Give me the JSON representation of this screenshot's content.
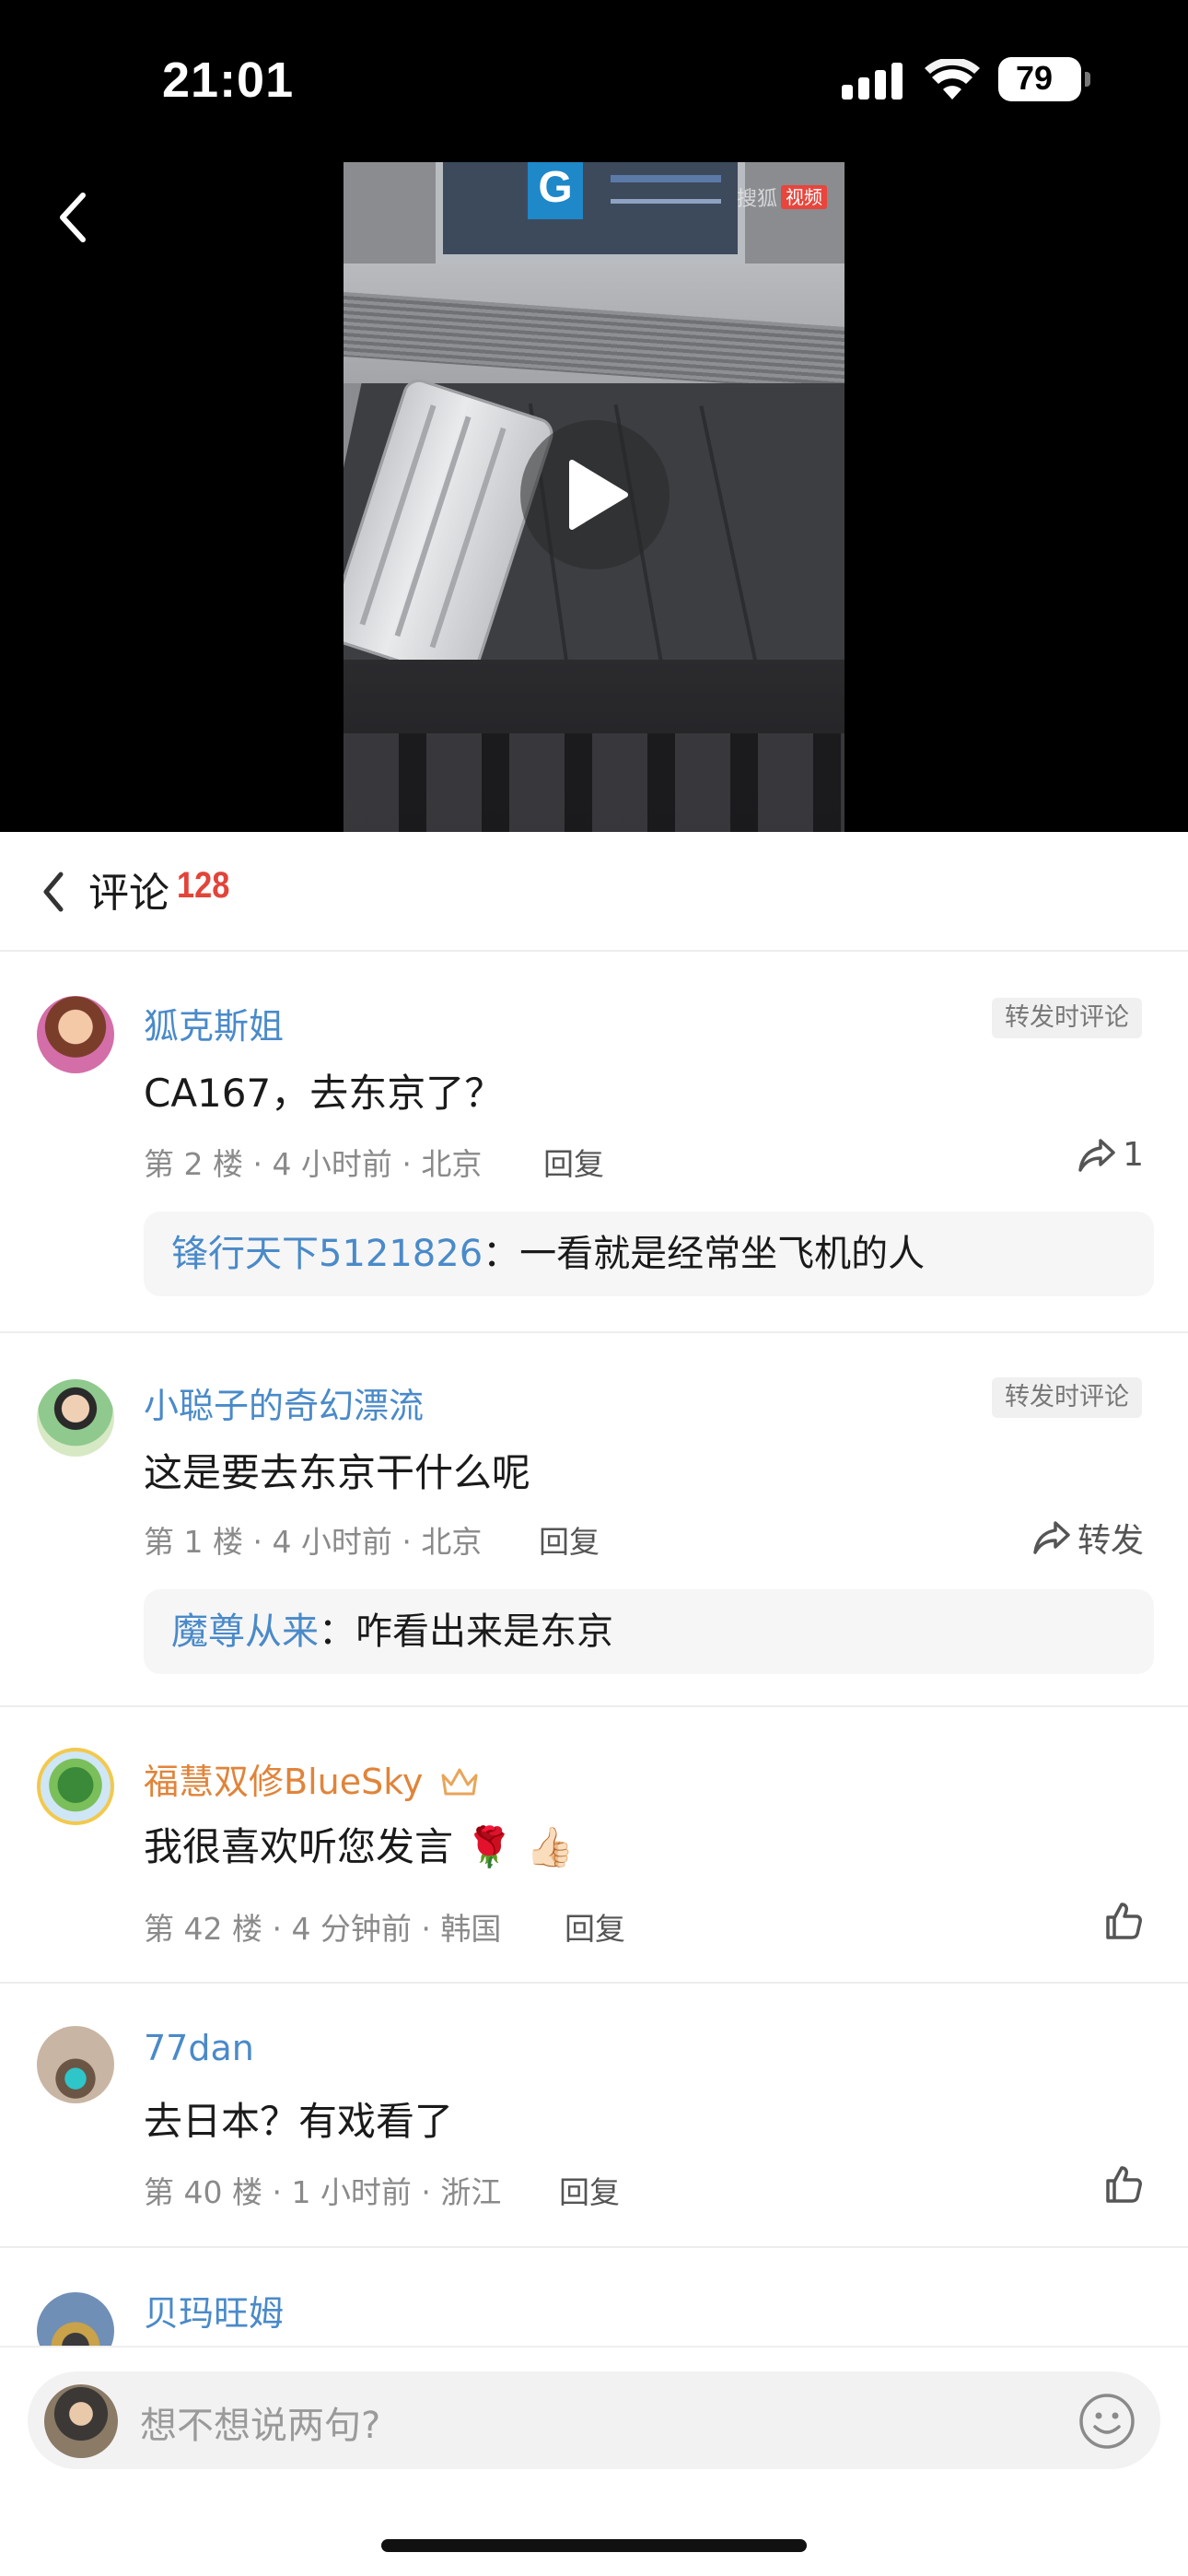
{
  "status_bar": {
    "time": "21:01",
    "battery": "79"
  },
  "video": {
    "badge_source": "搜狐",
    "badge_tag": "视频",
    "sign_letter": "G"
  },
  "comments_header": {
    "title": "评论",
    "count": "128"
  },
  "comments": [
    {
      "name": "狐克斯姐",
      "tag": "转发时评论",
      "text": "CA167，去东京了？",
      "meta": "第 2 楼 · 4 小时前 · 北京",
      "reply": "回复",
      "action_count": "1",
      "sub_reply": {
        "name": "锋行天下5121826",
        "sep": "：",
        "text": "一看就是经常坐飞机的人"
      }
    },
    {
      "name": "小聪子的奇幻漂流",
      "tag": "转发时评论",
      "text": "这是要去东京干什么呢",
      "meta": "第 1 楼 · 4 小时前 · 北京",
      "reply": "回复",
      "action_label": "转发",
      "sub_reply": {
        "name": "魔尊从来",
        "sep": "：",
        "text": "咋看出来是东京"
      }
    },
    {
      "name": "福慧双修BlueSky",
      "text": "我很喜欢听您发言 🌹 👍🏻",
      "meta": "第 42 楼 · 4 分钟前 · 韩国",
      "reply": "回复"
    },
    {
      "name": "77dan",
      "text": "去日本？有戏看了",
      "meta": "第 40 楼 · 1 小时前 · 浙江",
      "reply": "回复"
    },
    {
      "name": "贝玛旺姆"
    }
  ],
  "input": {
    "placeholder": "想不想说两句?"
  },
  "icons": {
    "back": "chevron-left-icon",
    "play": "play-icon",
    "forward": "forward-arrow-icon",
    "like": "thumbs-up-icon",
    "emoji": "smiley-icon",
    "crown": "crown-icon"
  },
  "colors": {
    "name_blue": "#4a8ac9",
    "vip_orange": "#e0843a",
    "count_red": "#e2443a"
  }
}
